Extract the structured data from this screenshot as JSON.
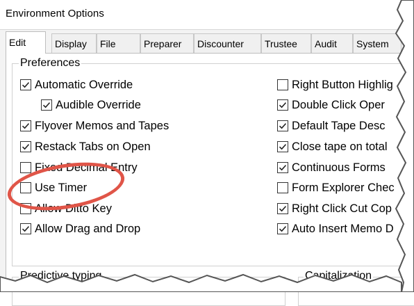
{
  "window": {
    "title": "Environment Options"
  },
  "tabs": [
    {
      "label": "Edit",
      "active": true
    },
    {
      "label": "Display",
      "active": false
    },
    {
      "label": "File",
      "active": false
    },
    {
      "label": "Preparer",
      "active": false
    },
    {
      "label": "Discounter",
      "active": false
    },
    {
      "label": "Trustee",
      "active": false
    },
    {
      "label": "Audit",
      "active": false
    },
    {
      "label": "System",
      "active": false
    }
  ],
  "preferences": {
    "label": "Preferences",
    "left": [
      {
        "label": "Automatic Override",
        "checked": true
      },
      {
        "label": "Audible Override",
        "checked": true
      },
      {
        "label": "Flyover Memos and Tapes",
        "checked": true
      },
      {
        "label": "Restack Tabs on Open",
        "checked": true
      },
      {
        "label": "Fixed Decimal Entry",
        "checked": false
      },
      {
        "label": "Use Timer",
        "checked": false
      },
      {
        "label": "Allow Ditto Key",
        "checked": false
      },
      {
        "label": "Allow Drag and Drop",
        "checked": true
      }
    ],
    "right": [
      {
        "label": "Right Button Highlig",
        "checked": false
      },
      {
        "label": "Double Click Oper",
        "checked": true
      },
      {
        "label": "Default Tape Desc",
        "checked": true
      },
      {
        "label": "Close tape on total",
        "checked": true
      },
      {
        "label": "Continuous Forms",
        "checked": true
      },
      {
        "label": "Form Explorer Chec",
        "checked": false
      },
      {
        "label": "Right Click Cut Cop",
        "checked": true
      },
      {
        "label": "Auto Insert Memo D",
        "checked": true
      }
    ]
  },
  "predictive_typing": {
    "label": "Predictive typing"
  },
  "capitalization": {
    "label": "Capitalization"
  },
  "colors": {
    "highlight": "#e05548",
    "panel": "#ffffff",
    "chrome": "#f3f3f3"
  }
}
